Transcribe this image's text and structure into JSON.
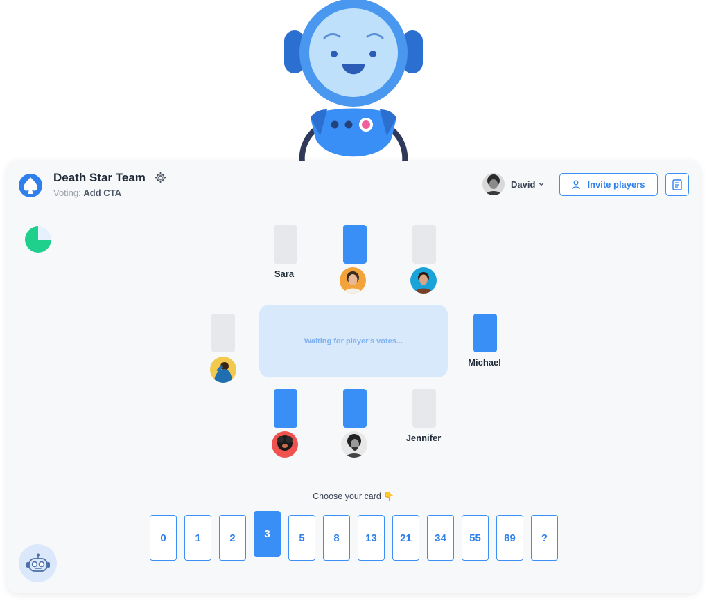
{
  "header": {
    "team_name": "Death Star Team",
    "voting_prefix": "Voting:",
    "voting_item": "Add CTA",
    "user_name": "David",
    "invite_label": "Invite players"
  },
  "table": {
    "message": "Waiting for player's votes..."
  },
  "players": [
    {
      "name": "Sara",
      "voted": false,
      "avatar": "name"
    },
    {
      "name": "",
      "voted": true,
      "avatar": "woman-smiling"
    },
    {
      "name": "",
      "voted": false,
      "avatar": "man-blue-bg"
    },
    {
      "name": "",
      "voted": false,
      "avatar": "man-yellow-bg"
    },
    {
      "name": "Michael",
      "voted": true,
      "avatar": "name"
    },
    {
      "name": "",
      "voted": true,
      "avatar": "dog-red-bg"
    },
    {
      "name": "",
      "voted": true,
      "avatar": "man-bw"
    },
    {
      "name": "Jennifer",
      "voted": false,
      "avatar": "name"
    }
  ],
  "deck": {
    "prompt": "Choose your card 👇",
    "cards": [
      "0",
      "1",
      "2",
      "3",
      "5",
      "8",
      "13",
      "21",
      "34",
      "55",
      "89",
      "?"
    ],
    "selected": "3"
  },
  "timer": {
    "progress": 0.75,
    "color": "#1fcf8c"
  },
  "colors": {
    "accent": "#3a8ff7",
    "table": "#d9e9fc",
    "card_empty": "#e6e8eb"
  }
}
